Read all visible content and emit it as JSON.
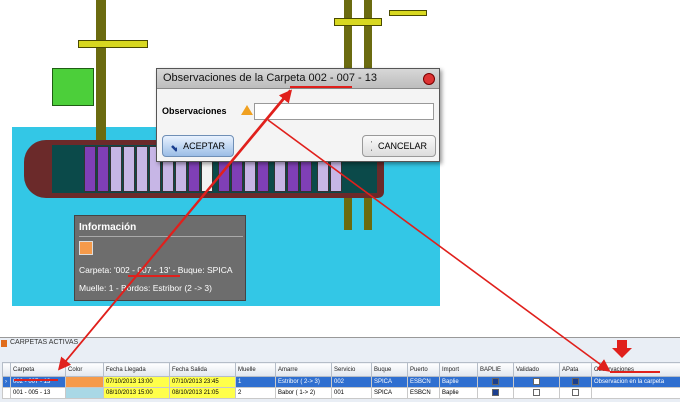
{
  "dialog": {
    "title": "Observaciones de la Carpeta 002 - 007 - 13",
    "field_label": "Observaciones",
    "field_value": "",
    "ok_label": "ACEPTAR",
    "cancel_label": "CANCELAR"
  },
  "info": {
    "title": "Información",
    "color": "#f59a4a",
    "line1": "Carpeta: '002 - 007 - 13' - Buque: SPICA",
    "line2": "Muelle: 1 - Bordos: Estribor (2 -> 3)"
  },
  "panel": {
    "title": "CARPETAS ACTIVAS",
    "columns": [
      "Carpeta",
      "Color",
      "Fecha Llegada",
      "Fecha Salida",
      "Muelle",
      "Amarre",
      "Servicio",
      "Buque",
      "Puerto",
      "Import",
      "BAPLIE",
      "Validado",
      "APata",
      "Observaciones"
    ],
    "rows": [
      {
        "carpeta": "002 - 007 - 13",
        "color": "#f59a4a",
        "llegada": "07/10/2013 13:00",
        "salida": "07/10/2013 23:45",
        "muelle": "1",
        "amarre": "Estribor ( 2-> 3)",
        "servicio": "002",
        "buque": "SPICA",
        "puerto": "ESBCN",
        "import": "Baplie",
        "baplie": true,
        "validado": false,
        "apata": true,
        "obs": "Observacion en la carpeta"
      },
      {
        "carpeta": "001 - 005 - 13",
        "color": "#a9d8e6",
        "llegada": "08/10/2013 15:00",
        "salida": "08/10/2013 21:05",
        "muelle": "2",
        "amarre": "Babor ( 1-> 2)",
        "servicio": "001",
        "buque": "SPICA",
        "puerto": "ESBCN",
        "import": "Baplie",
        "baplie": true,
        "validado": false,
        "apata": false,
        "obs": ""
      }
    ]
  },
  "colors": {
    "accent": "#e0201c",
    "selection": "#2f6fd0",
    "highlight": "#ffff4a"
  }
}
